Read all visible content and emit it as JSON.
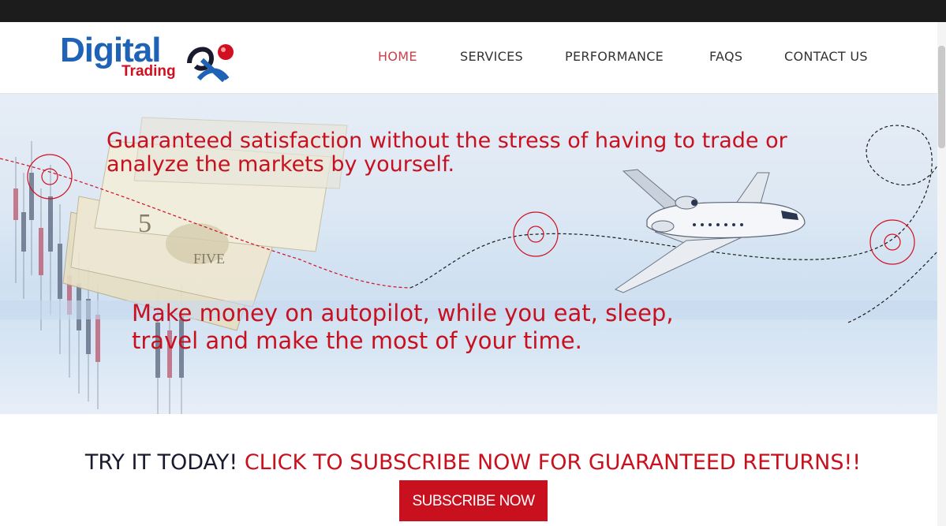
{
  "logo": {
    "word1": "Digital",
    "word2": "Trading"
  },
  "nav": {
    "items": [
      {
        "label": "HOME",
        "active": true
      },
      {
        "label": "SERVICES",
        "active": false
      },
      {
        "label": "PERFORMANCE",
        "active": false
      },
      {
        "label": "FAQS",
        "active": false
      },
      {
        "label": "CONTACT US",
        "active": false
      }
    ]
  },
  "hero": {
    "headline": "Guaranteed satisfaction without the stress of having to trade or analyze the markets by yourself.",
    "subline": "Make money on autopilot, while you eat, sleep, travel and make the most of your time."
  },
  "cta": {
    "lead": "TRY IT TODAY!",
    "highlight": "CLICK TO SUBSCRIBE NOW FOR GUARANTEED RETURNS!!",
    "button_label": "SUBSCRIBE NOW"
  },
  "colors": {
    "brand_blue": "#1f63b6",
    "brand_red": "#c8101e",
    "nav_active": "#c8414a",
    "top_bar": "#1c1c1c"
  },
  "icons": [
    "logo-mark-icon",
    "airplane-icon",
    "target-circle-icon",
    "flight-path-icon"
  ]
}
